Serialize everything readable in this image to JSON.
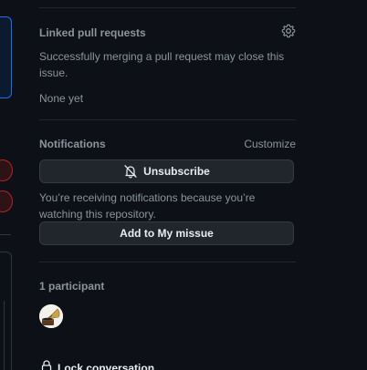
{
  "linked_prs": {
    "heading": "Linked pull requests",
    "description": "Successfully merging a pull request may close this issue.",
    "empty_text": "None yet",
    "settings_icon": "gear-icon"
  },
  "notifications": {
    "heading": "Notifications",
    "customize_label": "Customize",
    "unsubscribe_label": "Unsubscribe",
    "unsubscribe_icon": "bell-slash-icon",
    "reason_text": "You’re receiving notifications because you’re watching this repository.",
    "add_label": "Add to My missue"
  },
  "participants": {
    "heading": "1 participant",
    "avatar_icon": "gramophone-avatar"
  },
  "lock": {
    "label": "Lock conversation",
    "icon": "lock-icon"
  },
  "colors": {
    "background": "#0d1117",
    "text_muted": "#8b949e",
    "text_primary": "#e6edf3",
    "button_bg": "#21262d",
    "border": "#30363d"
  }
}
